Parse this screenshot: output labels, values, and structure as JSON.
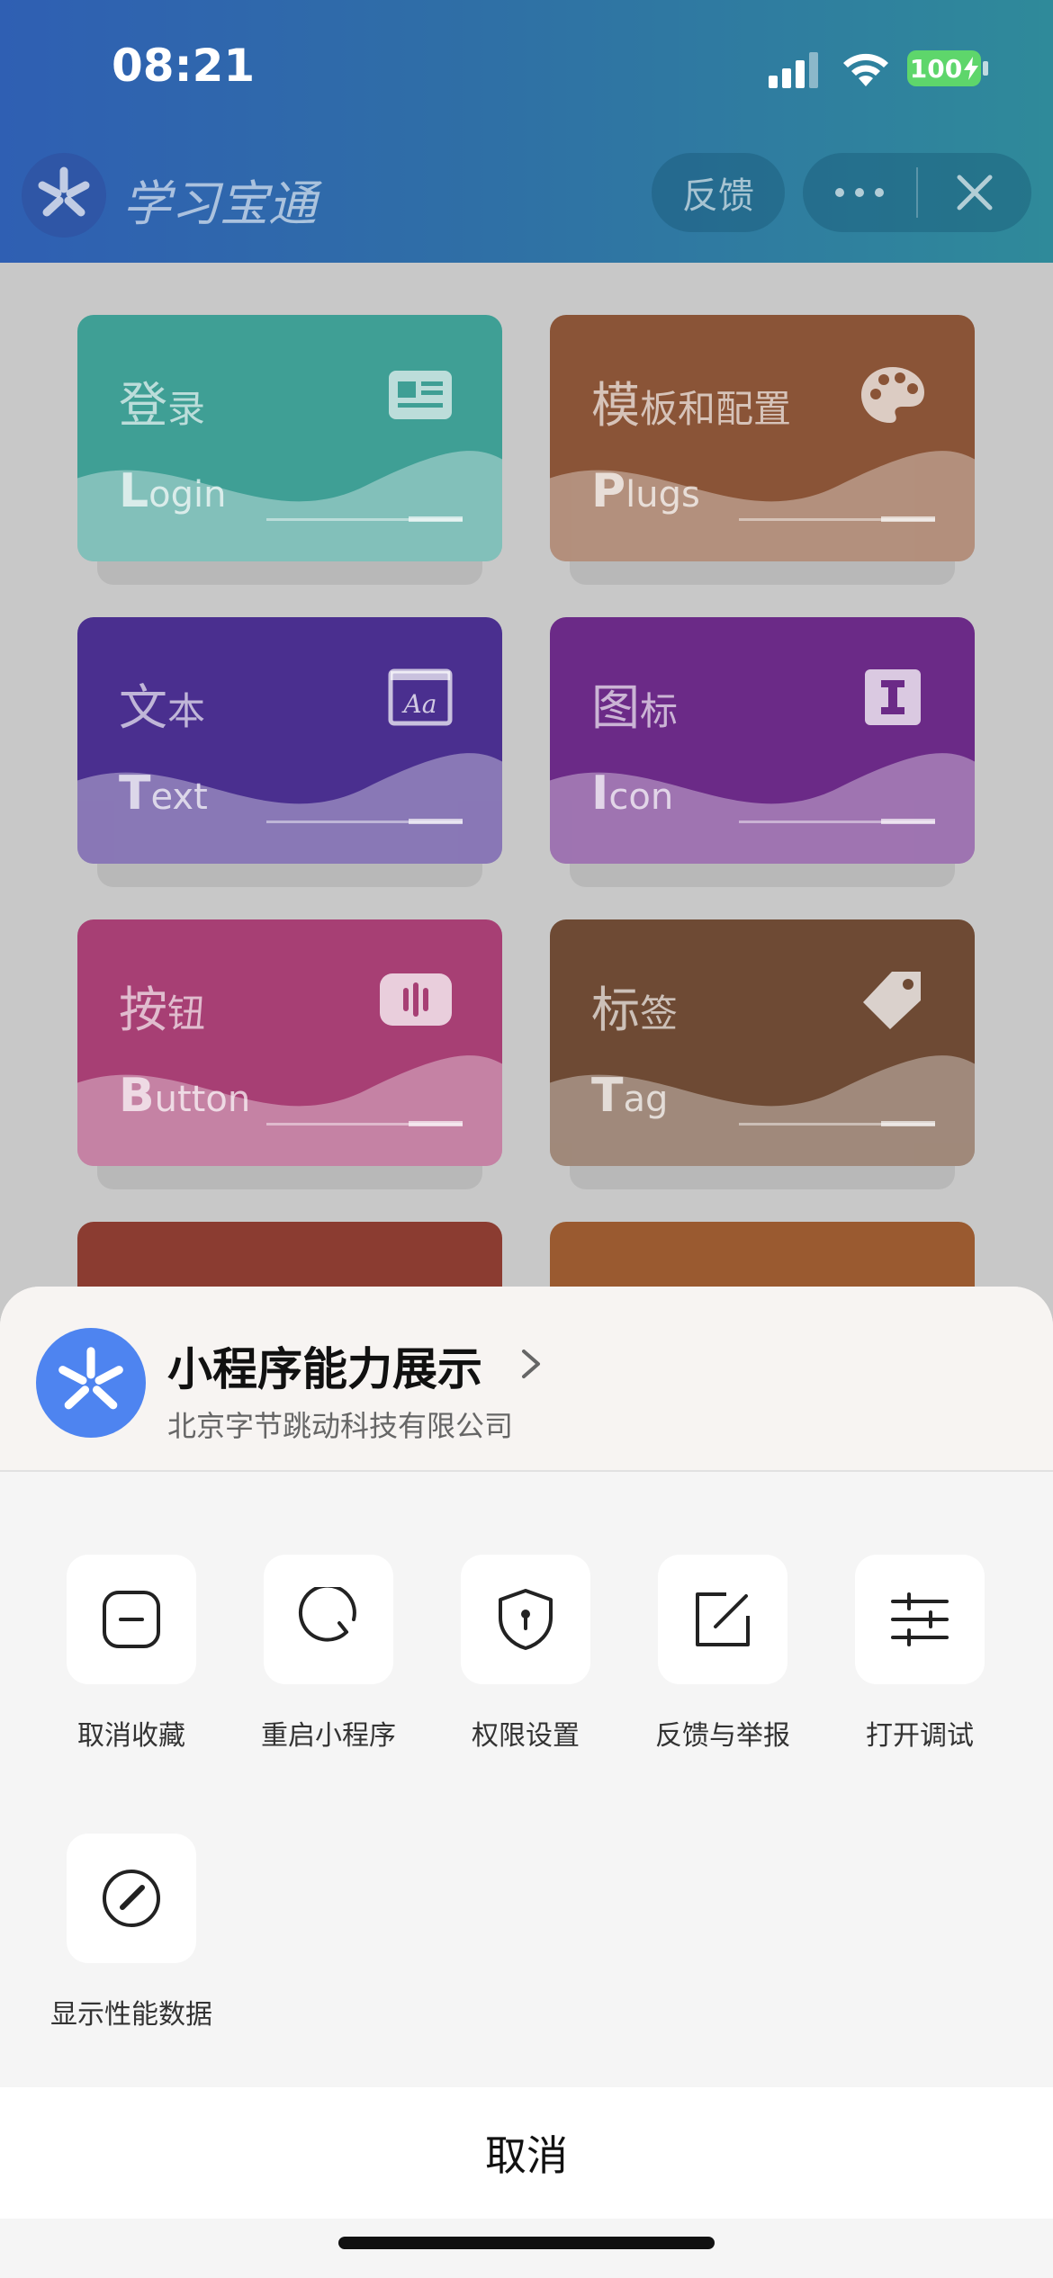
{
  "status_bar": {
    "time": "08:21",
    "battery": "100"
  },
  "header": {
    "app_title": "学习宝通",
    "feedback_label": "反馈",
    "more_label": "•••"
  },
  "cards": [
    {
      "zh_main": "登",
      "zh_rest": "录",
      "en_first": "L",
      "en_rest": "ogin",
      "color": "#3f9f95",
      "icon": "id-card-icon"
    },
    {
      "zh_main": "模",
      "zh_rest": "板和配置",
      "en_first": "P",
      "en_rest": "lugs",
      "color": "#8a5437",
      "icon": "palette-icon"
    },
    {
      "zh_main": "文",
      "zh_rest": "本",
      "en_first": "T",
      "en_rest": "ext",
      "color": "#4a2f8f",
      "icon": "text-window-icon"
    },
    {
      "zh_main": "图",
      "zh_rest": "标",
      "en_first": "I",
      "en_rest": "con",
      "color": "#6b2a87",
      "icon": "font-i-icon"
    },
    {
      "zh_main": "按",
      "zh_rest": "钮",
      "en_first": "B",
      "en_rest": "utton",
      "color": "#a73f74",
      "icon": "button-icon"
    },
    {
      "zh_main": "标",
      "zh_rest": "签",
      "en_first": "T",
      "en_rest": "ag",
      "color": "#6e4a34",
      "icon": "tag-icon"
    },
    {
      "color": "#8b3c31"
    },
    {
      "color": "#9a5a30"
    }
  ],
  "sheet": {
    "mini_program_name": "小程序能力展示",
    "company": "北京字节跳动科技有限公司",
    "actions": [
      {
        "label": "取消收藏",
        "icon": "unfavorite-icon"
      },
      {
        "label": "重启小程序",
        "icon": "restart-icon"
      },
      {
        "label": "权限设置",
        "icon": "shield-icon"
      },
      {
        "label": "反馈与举报",
        "icon": "edit-report-icon"
      },
      {
        "label": "打开调试",
        "icon": "sliders-icon"
      },
      {
        "label": "显示性能数据",
        "icon": "gauge-icon"
      }
    ],
    "cancel_label": "取消"
  }
}
